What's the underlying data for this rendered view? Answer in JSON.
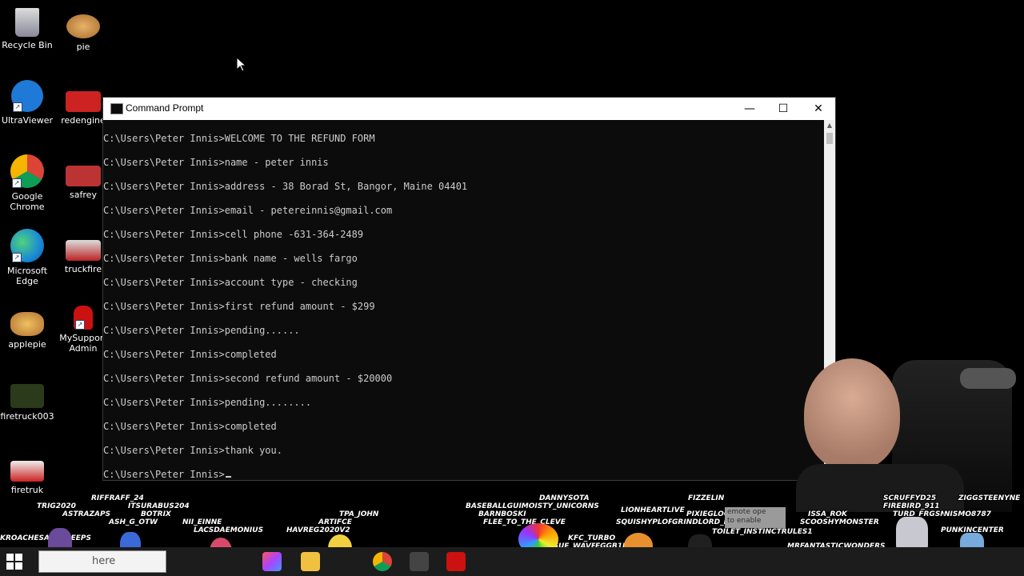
{
  "desktop": {
    "icons": [
      {
        "label": "Recycle Bin"
      },
      {
        "label": "pie"
      },
      {
        "label": "UltraViewer"
      },
      {
        "label": "redengine"
      },
      {
        "label": "Google Chrome"
      },
      {
        "label": "safrey"
      },
      {
        "label": "Microsoft Edge"
      },
      {
        "label": "truckfire"
      },
      {
        "label": "applepie"
      },
      {
        "label": "MySupport Admin"
      },
      {
        "label": "firetruck003"
      },
      {
        "label": "firetruk"
      }
    ]
  },
  "window": {
    "title": "Command Prompt",
    "minimize": "—",
    "maximize": "☐",
    "close": "✕"
  },
  "console": {
    "lines": [
      "C:\\Users\\Peter Innis>WELCOME TO THE REFUND FORM",
      "C:\\Users\\Peter Innis>name - peter innis",
      "C:\\Users\\Peter Innis>address - 38 Borad St, Bangor, Maine 04401",
      "C:\\Users\\Peter Innis>email - petereinnis@gmail.com",
      "C:\\Users\\Peter Innis>cell phone -631-364-2489",
      "C:\\Users\\Peter Innis>bank name - wells fargo",
      "C:\\Users\\Peter Innis>account type - checking",
      "C:\\Users\\Peter Innis>first refund amount - $299",
      "C:\\Users\\Peter Innis>pending......",
      "C:\\Users\\Peter Innis>completed",
      "C:\\Users\\Peter Innis>second refund amount - $20000",
      "C:\\Users\\Peter Innis>pending........",
      "C:\\Users\\Peter Innis>completed",
      "C:\\Users\\Peter Innis>thank you.",
      "C:\\Users\\Peter Innis>"
    ]
  },
  "overlay": {
    "names": [
      "RIFFRAFF_24",
      "TRIG2020",
      "ITSURABUS204",
      "ASTRAZAPS",
      "BOTRIX",
      "ASH_G_OTW",
      "NII_EINNE",
      "LACSDAEMONIUS",
      "TPA_JOHN",
      "ARTIFCE",
      "HAVREG2020V2",
      "KROACHESARECREEPS",
      "DANNYSOTA",
      "BASEBALLGUIMOISTY_UNICORNS",
      "BARNBOSKI",
      "FLEE_TO_THE_CLEVE",
      "FIZZELIN",
      "LIONHEARTLIVE",
      "PIXIEGLOOM",
      "SQUISHYPLOPS",
      "GRINDLORD_EQ",
      "KFC_TURBO",
      "ROGUE_WAVE",
      "EGGB1RD",
      "TOILET_INSTINCTRULES1",
      "ISSA_ROK",
      "SCOOSHYMONSTER",
      "SCRUFFYD25",
      "FIREBIRD_911",
      "TURD_FRGSN",
      "ZIGGSTEENYNE",
      "NISMO8787",
      "PUNKINCENTER",
      "MRFANTASTICWONDERS"
    ],
    "notice": "emote ope\nto enable"
  },
  "taskbar": {
    "search_text": "here"
  },
  "colors": {
    "console_bg": "#0c0c0c",
    "console_text": "#cccccc",
    "titlebar": "#ffffff",
    "taskbar": "#1c1c1c"
  }
}
